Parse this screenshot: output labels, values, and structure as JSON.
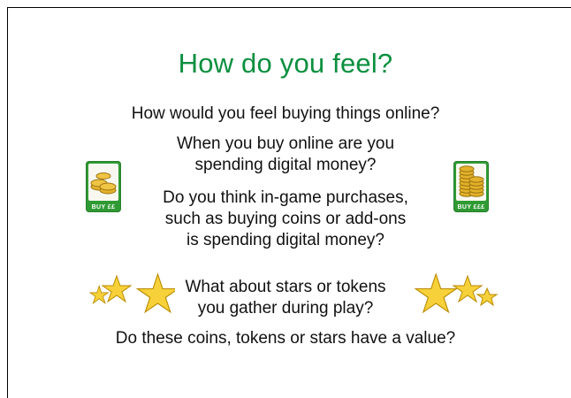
{
  "slide": {
    "title": "How do you feel?",
    "questions": {
      "q1": "How would you feel buying things online?",
      "q2_line1": "When you buy online are you",
      "q2_line2": "spending digital money?",
      "q3_line1": "Do you think in-game purchases,",
      "q3_line2": "such as buying coins or add-ons",
      "q3_line3": "is spending digital money?",
      "q4_line1": "What about stars or tokens",
      "q4_line2": "you gather during play?",
      "q5": "Do these coins, tokens or stars have a value?"
    },
    "left_card": {
      "label": "BUY ££",
      "icon": "coins-small-stack-icon"
    },
    "right_card": {
      "label": "BUY £££",
      "icon": "coins-tall-stack-icon"
    },
    "decorations": {
      "left_stars_icon": "stars-left-icon",
      "right_stars_icon": "stars-right-icon"
    },
    "colors": {
      "title": "#0b8f3f",
      "card_green": "#2f9a33",
      "star_fill": "#f7d13a",
      "star_stroke": "#b88a00",
      "coin_fill": "#e3b12b"
    }
  }
}
